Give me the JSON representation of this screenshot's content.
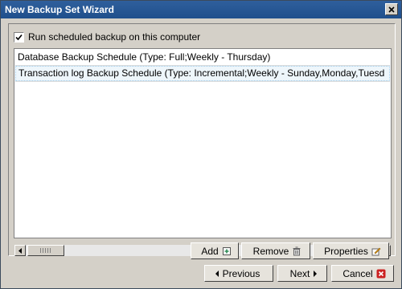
{
  "window": {
    "title": "New Backup Set Wizard"
  },
  "schedule": {
    "checkbox_label": "Run scheduled backup on this computer",
    "checked": true,
    "items": [
      {
        "label": "Database Backup Schedule (Type: Full;Weekly - Thursday)"
      },
      {
        "label": "Transaction log Backup Schedule (Type: Incremental;Weekly - Sunday,Monday,Tuesd"
      }
    ]
  },
  "list_buttons": {
    "add": "Add",
    "remove": "Remove",
    "properties": "Properties"
  },
  "nav_buttons": {
    "previous": "Previous",
    "next": "Next",
    "cancel": "Cancel"
  },
  "colors": {
    "titlebar": "#1f4f8c",
    "cancel_icon": "#cc2222",
    "add_icon": "#2e8b57"
  }
}
